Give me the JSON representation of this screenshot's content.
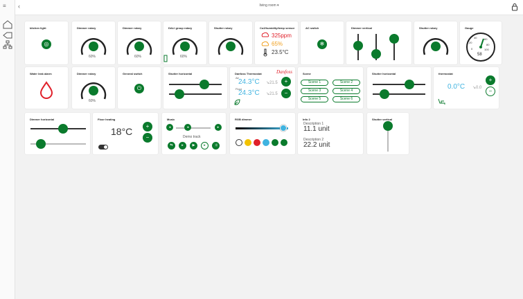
{
  "header": {
    "breadcrumb": "living room ▾"
  },
  "colors": {
    "accent": "#0a7a2c",
    "blue": "#3fb3e0",
    "red": "#e0202a",
    "orange": "#f0a020"
  },
  "cards": {
    "kitchen_light": {
      "title": "kitchen light"
    },
    "dimmer1": {
      "title": "Dimmer rotary",
      "pct": "60%"
    },
    "dimmer2": {
      "title": "Dimmer rotary",
      "pct": "60%"
    },
    "dali": {
      "title": "DALI group rotary",
      "pct": "60%"
    },
    "shutter_rot1": {
      "title": "Shutter rotary"
    },
    "co2": {
      "title": "Co2/humidity/temp sensor",
      "co2": "325ppm",
      "humidity": "65%",
      "temp": "23.5°C"
    },
    "ac": {
      "title": "AC switch"
    },
    "dimmer_vert": {
      "title": "Dimmer vertical"
    },
    "shutter_rot2": {
      "title": "Shutter rotary"
    },
    "gauge": {
      "title": "Gauge",
      "value": "58",
      "ticks": [
        "0",
        "20",
        "40",
        "60",
        "80",
        "100"
      ]
    },
    "water": {
      "title": "Water leak alarm"
    },
    "dimmer3": {
      "title": "Dimmer rotary",
      "pct": "60%"
    },
    "general": {
      "title": "General switch"
    },
    "shutter_h1": {
      "title": "Shutter horizontal"
    },
    "danfoss": {
      "title": "Danfoss Thermostat",
      "brand": "Danfoss",
      "air_label": "Air",
      "air_temp": "24.3°C",
      "air_set": "↘21.5",
      "floor_label": "Floor",
      "floor_temp": "24.3°C",
      "floor_set": "↘21.5"
    },
    "scene": {
      "title": "Scene",
      "items": [
        "Scene 1",
        "Scene 2",
        "Scene 3",
        "Scene 4",
        "Scene 5",
        "Scene 6"
      ]
    },
    "shutter_h2": {
      "title": "Shutter horizontal"
    },
    "thermostat": {
      "title": "thermostat",
      "temp": "0.0°C",
      "set": "↘0.0"
    },
    "dimmer_h": {
      "title": "Dimmer horizontal"
    },
    "floor": {
      "title": "Floor heating",
      "temp": "18°C"
    },
    "music": {
      "title": "Music",
      "track": "Demo track"
    },
    "rgb": {
      "title": "RGB dimmer",
      "swatches": [
        "#ffffff",
        "#f2c200",
        "#e0202a",
        "#3fb3e0",
        "#0a7a2c",
        "#0a7a2c"
      ]
    },
    "info": {
      "title": "Info 2",
      "d1_label": "Description 1",
      "d1_value": "11.1 unit",
      "d2_label": "Description 2",
      "d2_value": "22.2 unit"
    },
    "shutter_v": {
      "title": "Shutter vertical"
    }
  }
}
